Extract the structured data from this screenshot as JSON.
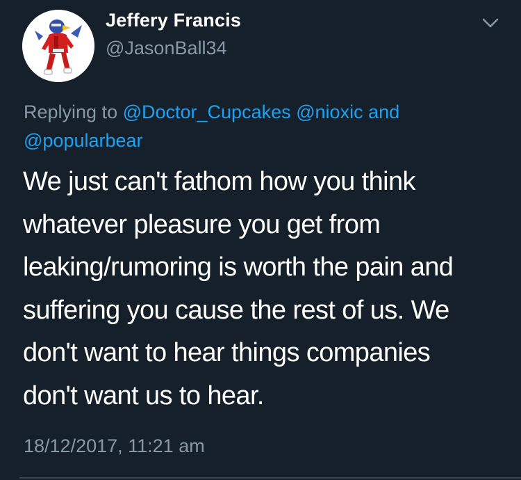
{
  "author": {
    "display_name": "Jeffery Francis",
    "handle": "@JasonBall34",
    "avatar_icon": "cartoon-character-avatar"
  },
  "menu": {
    "icon": "chevron-down-icon"
  },
  "reply": {
    "prefix": "Replying to ",
    "mentions": [
      "@Doctor_Cupcakes",
      "@nioxic",
      "@popularbear"
    ],
    "joiner": "and"
  },
  "tweet": {
    "lines": [
      "We just can't fathom how you think",
      "whatever pleasure you get from",
      "leaking/rumoring is worth the pain and",
      "suffering you cause the rest of us. We",
      "don't want to hear things companies",
      "don't want us to hear."
    ],
    "timestamp": "18/12/2017, 11:21 am"
  },
  "colors": {
    "background": "#15202b",
    "text": "#ffffff",
    "secondary": "#8899a6",
    "link": "#1da1f2"
  }
}
